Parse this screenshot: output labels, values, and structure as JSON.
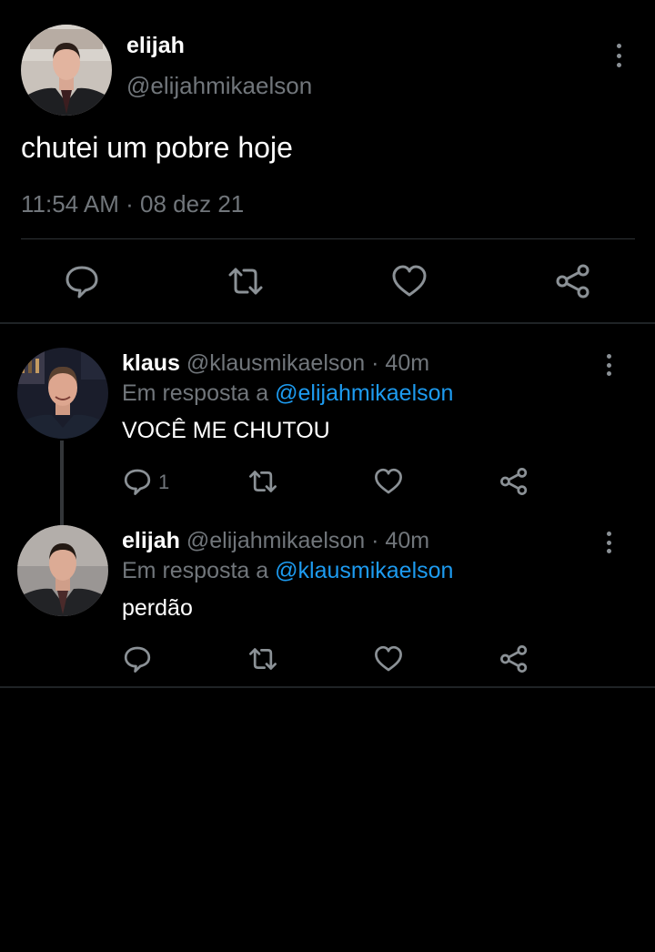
{
  "main_tweet": {
    "display_name": "elijah",
    "handle": "@elijahmikaelson",
    "text": "chutei um pobre hoje",
    "timestamp": "11:54 AM · 08 dez 21",
    "avatar": "elijah-avatar",
    "actions": [
      "reply-icon",
      "retweet-icon",
      "like-icon",
      "share-icon"
    ]
  },
  "replies": [
    {
      "display_name": "klaus",
      "handle": "@klausmikaelson",
      "time": "· 40m",
      "reply_prefix": "Em resposta a",
      "reply_to": "@elijahmikaelson",
      "text": "VOCÊ ME CHUTOU",
      "reply_count": "1",
      "avatar": "klaus-avatar"
    },
    {
      "display_name": "elijah",
      "handle": "@elijahmikaelson",
      "time": "· 40m",
      "reply_prefix": "Em resposta a",
      "reply_to": "@klausmikaelson",
      "text": "perdão",
      "reply_count": "",
      "avatar": "elijah-avatar"
    }
  ],
  "colors": {
    "background": "#000000",
    "text_primary": "#ffffff",
    "text_secondary": "#71767b",
    "mention": "#1d9bf0",
    "icon": "#8b9196",
    "divider": "#2f3336"
  }
}
